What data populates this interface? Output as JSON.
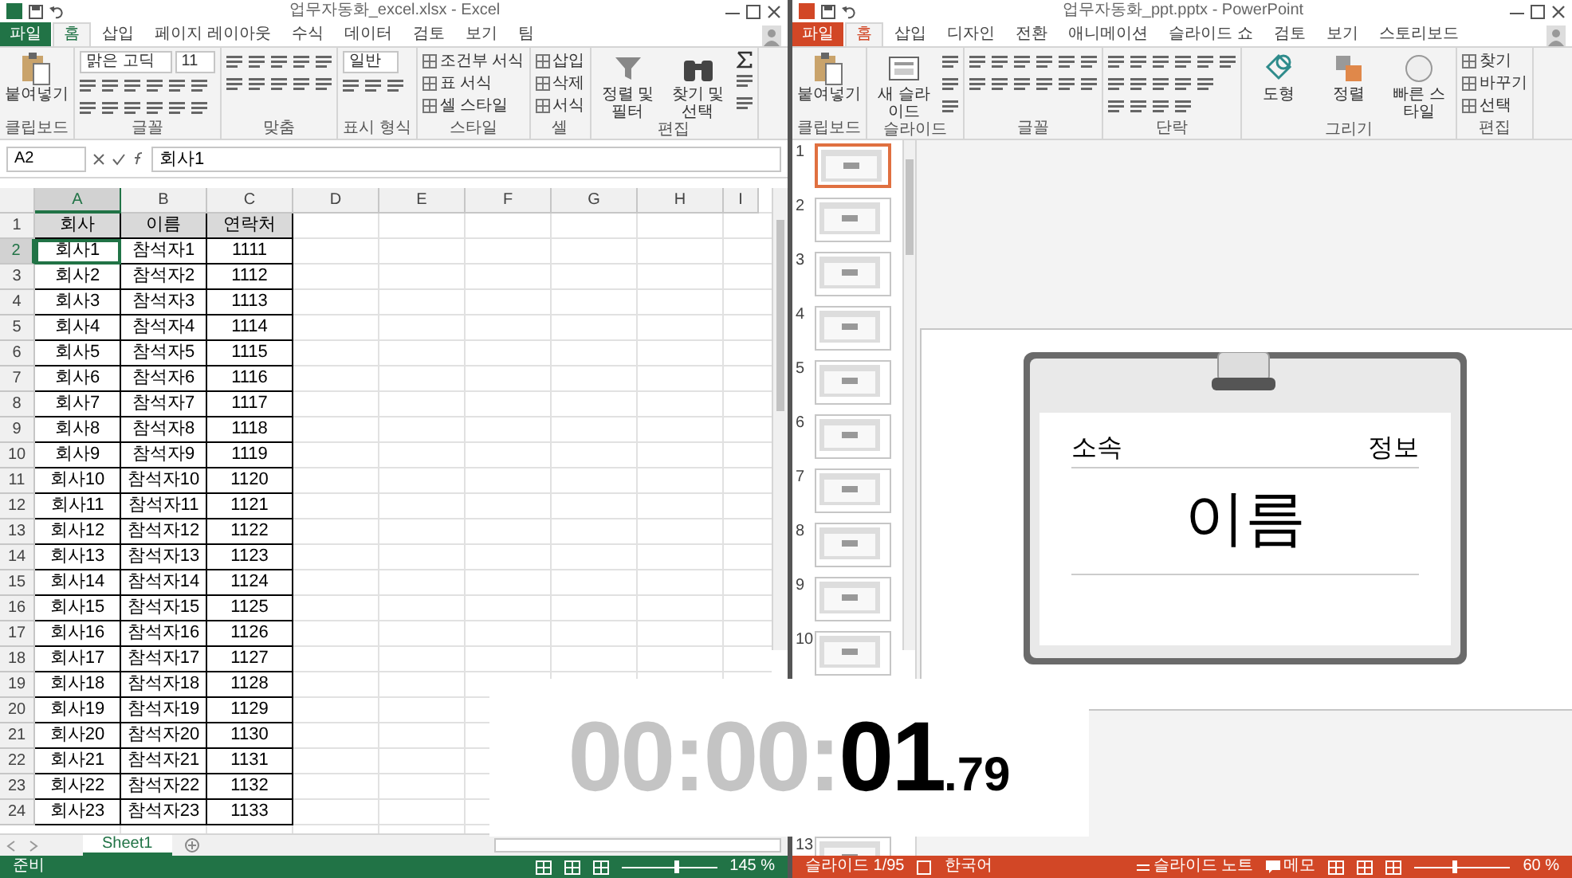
{
  "excel": {
    "title": "업무자동화_excel.xlsx - Excel",
    "tabs": [
      {
        "label": "파일",
        "kind": "file",
        "selected": false
      },
      {
        "label": "홈",
        "kind": "tab",
        "selected": true
      },
      {
        "label": "삽입",
        "kind": "tab",
        "selected": false
      },
      {
        "label": "페이지 레이아웃",
        "kind": "tab",
        "selected": false
      },
      {
        "label": "수식",
        "kind": "tab",
        "selected": false
      },
      {
        "label": "데이터",
        "kind": "tab",
        "selected": false
      },
      {
        "label": "검토",
        "kind": "tab",
        "selected": false
      },
      {
        "label": "보기",
        "kind": "tab",
        "selected": false
      },
      {
        "label": "팀",
        "kind": "tab",
        "selected": false
      }
    ],
    "groups": [
      {
        "label": "클립보드",
        "kind": "clipboard",
        "items": [
          {
            "kind": "paste",
            "label": "붙여넣기"
          }
        ]
      },
      {
        "label": "글꼴",
        "kind": "font",
        "items": [
          {
            "kind": "field",
            "label": "맑은 고딕"
          },
          {
            "kind": "field",
            "label": "11"
          }
        ]
      },
      {
        "label": "맞춤",
        "kind": "alignment"
      },
      {
        "label": "표시 형식",
        "kind": "number",
        "items": [
          {
            "kind": "field",
            "label": "일반"
          }
        ]
      },
      {
        "label": "스타일",
        "kind": "styles",
        "items": [
          {
            "kind": "small",
            "label": "조건부 서식"
          },
          {
            "kind": "small",
            "label": "표 서식"
          },
          {
            "kind": "small",
            "label": "셀 스타일"
          }
        ]
      },
      {
        "label": "셀",
        "kind": "cells",
        "items": [
          {
            "kind": "small",
            "label": "삽입"
          },
          {
            "kind": "small",
            "label": "삭제"
          },
          {
            "kind": "small",
            "label": "서식"
          }
        ]
      },
      {
        "label": "편집",
        "kind": "editing",
        "items": [
          {
            "kind": "sort",
            "label": "정렬 및 필터"
          },
          {
            "kind": "find",
            "label": "찾기 및 선택"
          }
        ]
      }
    ],
    "name_box": "A2",
    "formula": "회사1",
    "columns": [
      {
        "label": "A",
        "selected": true
      },
      {
        "label": "B",
        "selected": false
      },
      {
        "label": "C",
        "selected": false
      },
      {
        "label": "D",
        "selected": false
      },
      {
        "label": "E",
        "selected": false
      },
      {
        "label": "F",
        "selected": false
      },
      {
        "label": "G",
        "selected": false
      },
      {
        "label": "H",
        "selected": false
      },
      {
        "label": "I",
        "selected": false
      }
    ],
    "rows": [
      {
        "number": "1",
        "kind": "header",
        "selected": false,
        "cells": [
          "회사",
          "이름",
          "연락처"
        ]
      },
      {
        "number": "2",
        "kind": "data",
        "selected": true,
        "cells": [
          "회사1",
          "참석자1",
          "1111"
        ]
      },
      {
        "number": "3",
        "kind": "data",
        "selected": false,
        "cells": [
          "회사2",
          "참석자2",
          "1112"
        ]
      },
      {
        "number": "4",
        "kind": "data",
        "selected": false,
        "cells": [
          "회사3",
          "참석자3",
          "1113"
        ]
      },
      {
        "number": "5",
        "kind": "data",
        "selected": false,
        "cells": [
          "회사4",
          "참석자4",
          "1114"
        ]
      },
      {
        "number": "6",
        "kind": "data",
        "selected": false,
        "cells": [
          "회사5",
          "참석자5",
          "1115"
        ]
      },
      {
        "number": "7",
        "kind": "data",
        "selected": false,
        "cells": [
          "회사6",
          "참석자6",
          "1116"
        ]
      },
      {
        "number": "8",
        "kind": "data",
        "selected": false,
        "cells": [
          "회사7",
          "참석자7",
          "1117"
        ]
      },
      {
        "number": "9",
        "kind": "data",
        "selected": false,
        "cells": [
          "회사8",
          "참석자8",
          "1118"
        ]
      },
      {
        "number": "10",
        "kind": "data",
        "selected": false,
        "cells": [
          "회사9",
          "참석자9",
          "1119"
        ]
      },
      {
        "number": "11",
        "kind": "data",
        "selected": false,
        "cells": [
          "회사10",
          "참석자10",
          "1120"
        ]
      },
      {
        "number": "12",
        "kind": "data",
        "selected": false,
        "cells": [
          "회사11",
          "참석자11",
          "1121"
        ]
      },
      {
        "number": "13",
        "kind": "data",
        "selected": false,
        "cells": [
          "회사12",
          "참석자12",
          "1122"
        ]
      },
      {
        "number": "14",
        "kind": "data",
        "selected": false,
        "cells": [
          "회사13",
          "참석자13",
          "1123"
        ]
      },
      {
        "number": "15",
        "kind": "data",
        "selected": false,
        "cells": [
          "회사14",
          "참석자14",
          "1124"
        ]
      },
      {
        "number": "16",
        "kind": "data",
        "selected": false,
        "cells": [
          "회사15",
          "참석자15",
          "1125"
        ]
      },
      {
        "number": "17",
        "kind": "data",
        "selected": false,
        "cells": [
          "회사16",
          "참석자16",
          "1126"
        ]
      },
      {
        "number": "18",
        "kind": "data",
        "selected": false,
        "cells": [
          "회사17",
          "참석자17",
          "1127"
        ]
      },
      {
        "number": "19",
        "kind": "data",
        "selected": false,
        "cells": [
          "회사18",
          "참석자18",
          "1128"
        ]
      },
      {
        "number": "20",
        "kind": "data",
        "selected": false,
        "cells": [
          "회사19",
          "참석자19",
          "1129"
        ]
      },
      {
        "number": "21",
        "kind": "data",
        "selected": false,
        "cells": [
          "회사20",
          "참석자20",
          "1130"
        ]
      },
      {
        "number": "22",
        "kind": "data",
        "selected": false,
        "cells": [
          "회사21",
          "참석자21",
          "1131"
        ]
      },
      {
        "number": "23",
        "kind": "data",
        "selected": false,
        "cells": [
          "회사22",
          "참석자22",
          "1132"
        ]
      },
      {
        "number": "24",
        "kind": "data",
        "selected": false,
        "cells": [
          "회사23",
          "참석자23",
          "1133"
        ]
      }
    ],
    "sheet_tabs": [
      {
        "label": "Sheet1",
        "selected": true
      }
    ],
    "status": "준비",
    "zoom": {
      "level": 0.55,
      "reading": "145 %"
    }
  },
  "powerpoint": {
    "title": "업무자동화_ppt.pptx - PowerPoint",
    "tabs": [
      {
        "label": "파일",
        "kind": "file",
        "selected": false
      },
      {
        "label": "홈",
        "kind": "tab",
        "selected": true
      },
      {
        "label": "삽입",
        "kind": "tab",
        "selected": false
      },
      {
        "label": "디자인",
        "kind": "tab",
        "selected": false
      },
      {
        "label": "전환",
        "kind": "tab",
        "selected": false
      },
      {
        "label": "애니메이션",
        "kind": "tab",
        "selected": false
      },
      {
        "label": "슬라이드 쇼",
        "kind": "tab",
        "selected": false
      },
      {
        "label": "검토",
        "kind": "tab",
        "selected": false
      },
      {
        "label": "보기",
        "kind": "tab",
        "selected": false
      },
      {
        "label": "스토리보드",
        "kind": "tab",
        "selected": false
      }
    ],
    "groups": [
      {
        "label": "클립보드",
        "kind": "clipboard",
        "items": [
          {
            "kind": "paste",
            "label": "붙여넣기"
          }
        ]
      },
      {
        "label": "슬라이드",
        "kind": "slides",
        "items": [
          {
            "kind": "new_slide",
            "label": "새 슬라이드"
          }
        ]
      },
      {
        "label": "글꼴",
        "kind": "font"
      },
      {
        "label": "단락",
        "kind": "paragraph"
      },
      {
        "label": "그리기",
        "kind": "drawing",
        "items": [
          {
            "kind": "shapes",
            "label": "도형"
          },
          {
            "kind": "arrange",
            "label": "정렬"
          },
          {
            "kind": "quick_styles",
            "label": "빠른 스타일"
          }
        ]
      },
      {
        "label": "편집",
        "kind": "editing_ppt",
        "items": [
          {
            "kind": "small",
            "label": "찾기"
          },
          {
            "kind": "small",
            "label": "바꾸기"
          },
          {
            "kind": "small",
            "label": "선택"
          }
        ]
      }
    ],
    "slides": [
      {
        "number": "1",
        "selected": true
      },
      {
        "number": "2",
        "selected": false
      },
      {
        "number": "3",
        "selected": false
      },
      {
        "number": "4",
        "selected": false
      },
      {
        "number": "5",
        "selected": false
      },
      {
        "number": "6",
        "selected": false
      },
      {
        "number": "7",
        "selected": false
      },
      {
        "number": "8",
        "selected": false
      },
      {
        "number": "9",
        "selected": false
      },
      {
        "number": "10",
        "selected": false
      },
      {
        "number": "13",
        "selected": false
      }
    ],
    "slide": {
      "left_label": "소속",
      "right_label": "정보",
      "name": "이름"
    },
    "status": {
      "slide": "슬라이드 1/95",
      "language": "한국어",
      "notes": "슬라이드 노트",
      "comments": "메모",
      "zoom": {
        "level": 0.4,
        "reading": "60 %"
      }
    }
  },
  "stopwatch": {
    "dim": "00:00:",
    "seconds": "01",
    "fraction": ".79"
  }
}
